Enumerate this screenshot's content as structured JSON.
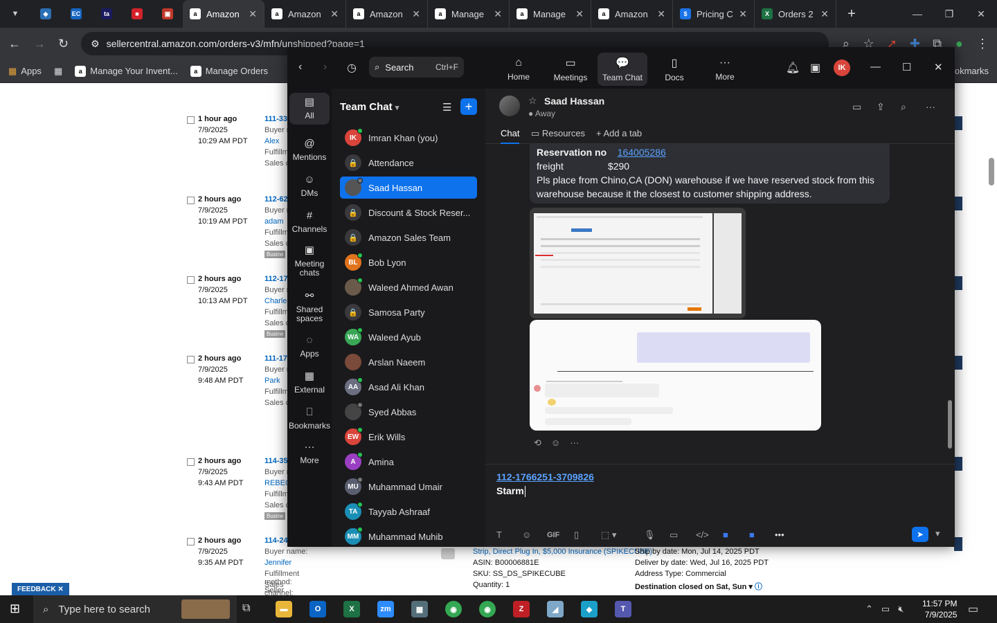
{
  "browser": {
    "tabs": [
      {
        "label": "Amazon",
        "active": true
      },
      {
        "label": "Amazon",
        "active": false
      },
      {
        "label": "Amazon",
        "active": false
      },
      {
        "label": "Manage",
        "active": false
      },
      {
        "label": "Manage",
        "active": false
      },
      {
        "label": "Amazon",
        "active": false
      },
      {
        "label": "Pricing C",
        "active": false
      },
      {
        "label": "Orders 2",
        "active": false
      }
    ],
    "url": "sellercentral.amazon.com/orders-v3/mfn/unshipped?page=1",
    "bookmarks": [
      "Apps",
      "Manage Your Invent...",
      "Manage Orders"
    ],
    "bookmarks_right": "ookmarks"
  },
  "amazon": {
    "orders": [
      {
        "ago": "1 hour ago",
        "date": "7/9/2025",
        "time": "10:29 AM PDT",
        "id": "111-33",
        "buyer_label": "Buyer n",
        "buyer": "Alex",
        "fm": "Fulfillm",
        "sc": "Sales c",
        "biz": ""
      },
      {
        "ago": "2 hours ago",
        "date": "7/9/2025",
        "time": "10:19 AM PDT",
        "id": "112-62",
        "buyer_label": "Buyer n",
        "buyer": "adam",
        "fm": "Fulfillm",
        "sc": "Sales c",
        "biz": "Busine"
      },
      {
        "ago": "2 hours ago",
        "date": "7/9/2025",
        "time": "10:13 AM PDT",
        "id": "112-17",
        "buyer_label": "Buyer n",
        "buyer": "Charles",
        "fm": "Fulfillm",
        "sc": "Sales c",
        "biz": "Busine"
      },
      {
        "ago": "2 hours ago",
        "date": "7/9/2025",
        "time": "9:48 AM PDT",
        "id": "111-17",
        "buyer_label": "Buyer n",
        "buyer": "Park",
        "fm": "Fulfillm",
        "sc": "Sales c",
        "biz": ""
      },
      {
        "ago": "2 hours ago",
        "date": "7/9/2025",
        "time": "9:43 AM PDT",
        "id": "114-35",
        "buyer_label": "Buyer n",
        "buyer": "REBECC",
        "fm": "Fulfillm",
        "sc": "Sales c",
        "biz": "Busine"
      },
      {
        "ago": "2 hours ago",
        "date": "7/9/2025",
        "time": "9:35 AM PDT",
        "id": "114-24",
        "buyer_label": "Buyer name:",
        "buyer": "Jennifer",
        "fm": "Fulfillment method: Seller",
        "sc": "Sales channel: Amazon.com",
        "biz": ""
      }
    ],
    "product": {
      "title": "Strip, Direct Plug In, $5,000 Insurance (SPIKECUBE)",
      "asin": "ASIN: B00006881E",
      "sku": "SKU: SS_DS_SPIKECUBE",
      "qty": "Quantity: 1",
      "ship_by": "Ship by date: Mon, Jul 14, 2025 PDT",
      "deliver_by": "Deliver by date: Wed, Jul 16, 2025 PDT",
      "address_type": "Address Type: Commercial",
      "destination": "Destination closed on Sat, Sun"
    },
    "feedback": "FEEDBACK"
  },
  "zoom": {
    "search_label": "Search",
    "search_hint": "Ctrl+F",
    "nav": [
      {
        "label": "Home",
        "icon": "home-icon",
        "glyph": "⌂"
      },
      {
        "label": "Meetings",
        "icon": "video-icon",
        "glyph": "▭"
      },
      {
        "label": "Team Chat",
        "icon": "chat-icon",
        "glyph": "💬"
      },
      {
        "label": "Docs",
        "icon": "docs-icon",
        "glyph": "▯"
      },
      {
        "label": "More",
        "icon": "more-icon",
        "glyph": "···"
      }
    ],
    "avatar_initials": "IK",
    "rail": [
      {
        "label": "All",
        "glyph": "▤"
      },
      {
        "label": "Mentions",
        "glyph": "@"
      },
      {
        "label": "DMs",
        "glyph": "☺"
      },
      {
        "label": "Channels",
        "glyph": "#"
      },
      {
        "label": "Meeting chats",
        "glyph": "▣"
      },
      {
        "label": "Shared spaces",
        "glyph": "⚯"
      },
      {
        "label": "Apps",
        "glyph": "◌"
      },
      {
        "label": "External",
        "glyph": "▦"
      },
      {
        "label": "Bookmarks",
        "glyph": "⎕"
      },
      {
        "label": "More",
        "glyph": "···"
      }
    ],
    "list_title": "Team Chat",
    "chats": [
      {
        "name": "Imran Khan (you)",
        "initials": "IK",
        "color": "#d9453b",
        "status": "online",
        "lock": false
      },
      {
        "name": "Attendance",
        "initials": "🔒",
        "color": "",
        "status": "",
        "lock": true
      },
      {
        "name": "Saad Hassan",
        "initials": "",
        "color": "#555555",
        "status": "away",
        "lock": false,
        "selected": true
      },
      {
        "name": "Discount & Stock Reser...",
        "initials": "🔒",
        "color": "",
        "status": "",
        "lock": true
      },
      {
        "name": "Amazon Sales Team",
        "initials": "🔒",
        "color": "",
        "status": "",
        "lock": true
      },
      {
        "name": "Bob Lyon",
        "initials": "BL",
        "color": "#e0731d",
        "status": "online",
        "lock": false
      },
      {
        "name": "Waleed Ahmed Awan",
        "initials": "",
        "color": "#6a5a4a",
        "status": "online",
        "lock": false
      },
      {
        "name": "Samosa Party",
        "initials": "🔒",
        "color": "",
        "status": "",
        "lock": true
      },
      {
        "name": "Waleed Ayub",
        "initials": "WA",
        "color": "#3aa757",
        "status": "online",
        "lock": false
      },
      {
        "name": "Arslan Naeem",
        "initials": "",
        "color": "#7a4a3a",
        "status": "",
        "lock": false
      },
      {
        "name": "Asad Ali Khan",
        "initials": "AA",
        "color": "#6b6f80",
        "status": "online",
        "lock": false
      },
      {
        "name": "Syed Abbas",
        "initials": "",
        "color": "#444444",
        "status": "away",
        "lock": false
      },
      {
        "name": "Erik Wills",
        "initials": "EW",
        "color": "#d9453b",
        "status": "online",
        "lock": false
      },
      {
        "name": "Amina",
        "initials": "A",
        "color": "#9b3fc2",
        "status": "online",
        "lock": false
      },
      {
        "name": "Muhammad Umair",
        "initials": "MU",
        "color": "#5a5f70",
        "status": "away",
        "lock": false
      },
      {
        "name": "Tayyab Ashraaf",
        "initials": "TA",
        "color": "#1a8fb5",
        "status": "online",
        "lock": false
      },
      {
        "name": "Muhammad Muhib",
        "initials": "MM",
        "color": "#1a8fb5",
        "status": "online",
        "lock": false
      }
    ],
    "conversation": {
      "name": "Saad Hassan",
      "status": "Away",
      "tabs": [
        "Chat",
        "Resources",
        "Add a tab"
      ],
      "message": {
        "reservation_label": "Reservation no",
        "reservation_no": "164005286",
        "freight_label": "freight",
        "freight": "$290",
        "body": "Pls place from   Chino,CA (DON) warehouse  if we have reserved stock from this warehouse because it the closest to customer shipping address."
      },
      "composer_link": "112-1766251-3709826",
      "composer_text": "Starm"
    }
  },
  "taskbar": {
    "search_placeholder": "Type here to search",
    "time": "11:57 PM",
    "date": "7/9/2025"
  }
}
